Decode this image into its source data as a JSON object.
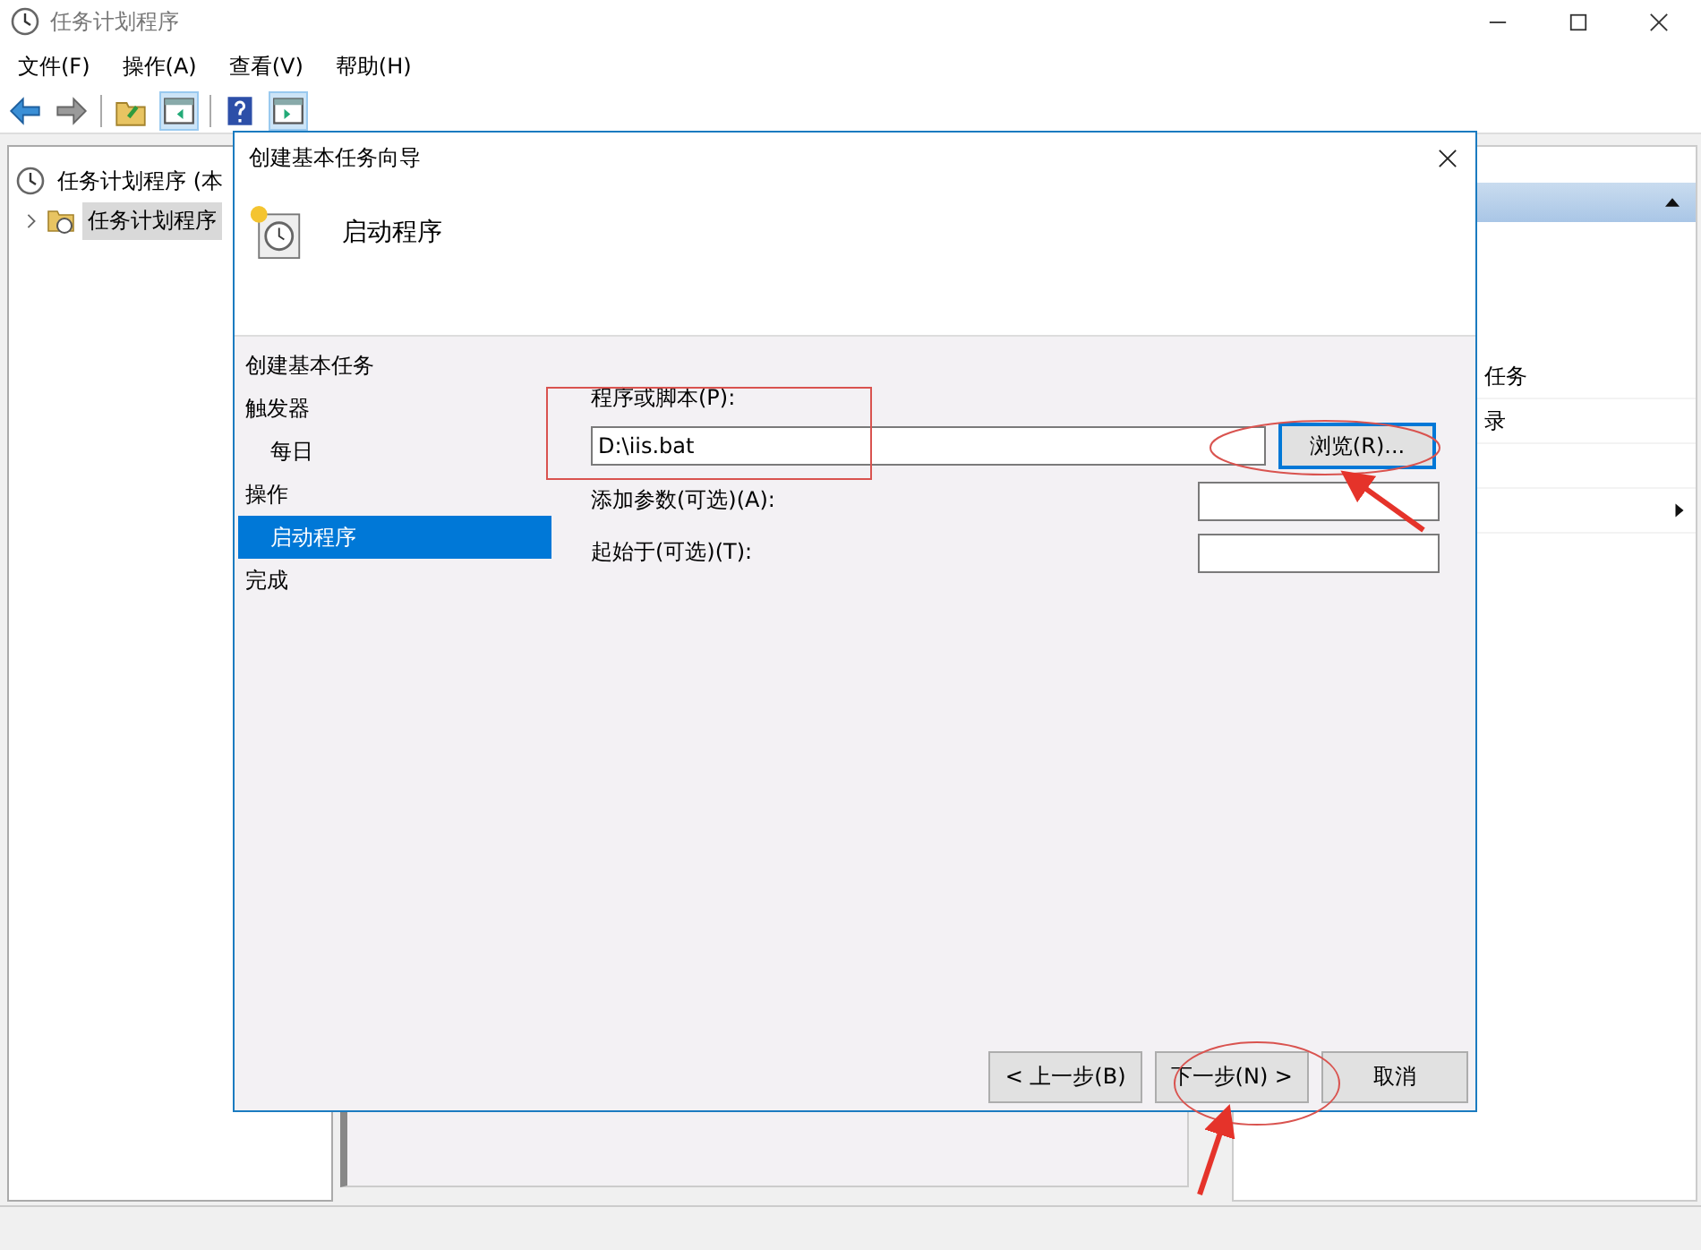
{
  "window": {
    "title": "任务计划程序"
  },
  "menu": [
    "文件(F)",
    "操作(A)",
    "查看(V)",
    "帮助(H)"
  ],
  "tree": [
    {
      "label": "任务计划程序 (本",
      "selected": false,
      "children": [
        {
          "label": "任务计划程序",
          "selected": true,
          "expanded": false
        }
      ]
    }
  ],
  "actions_pane": {
    "items": [
      {
        "label": "任务",
        "submenu": false
      },
      {
        "label": "录",
        "submenu": false
      },
      {
        "submenu": false
      },
      {
        "submenu": true
      }
    ]
  },
  "dialog": {
    "title": "创建基本任务向导",
    "heading": "启动程序",
    "steps": [
      {
        "label": "创建基本任务",
        "selected": false
      },
      {
        "label": "触发器",
        "selected": false,
        "children": [
          {
            "label": "每日",
            "selected": false
          }
        ]
      },
      {
        "label": "操作",
        "selected": false,
        "children": [
          {
            "label": "启动程序",
            "selected": true
          }
        ]
      },
      {
        "label": "完成",
        "selected": false
      }
    ],
    "fields": [
      {
        "kind": "wide",
        "label": "程序或脚本(P):",
        "value": "D:\\iis.bat"
      },
      {
        "kind": "short",
        "label": "添加参数(可选)(A):"
      },
      {
        "kind": "short",
        "label": "起始于(可选)(T):"
      }
    ],
    "browse_button": {
      "label": "浏览(R)...",
      "focused": true
    },
    "buttons": [
      {
        "label": "< 上一步(B)",
        "focused": false
      },
      {
        "label": "下一步(N) >",
        "focused": false
      },
      {
        "label": "取消",
        "focused": false
      }
    ]
  }
}
